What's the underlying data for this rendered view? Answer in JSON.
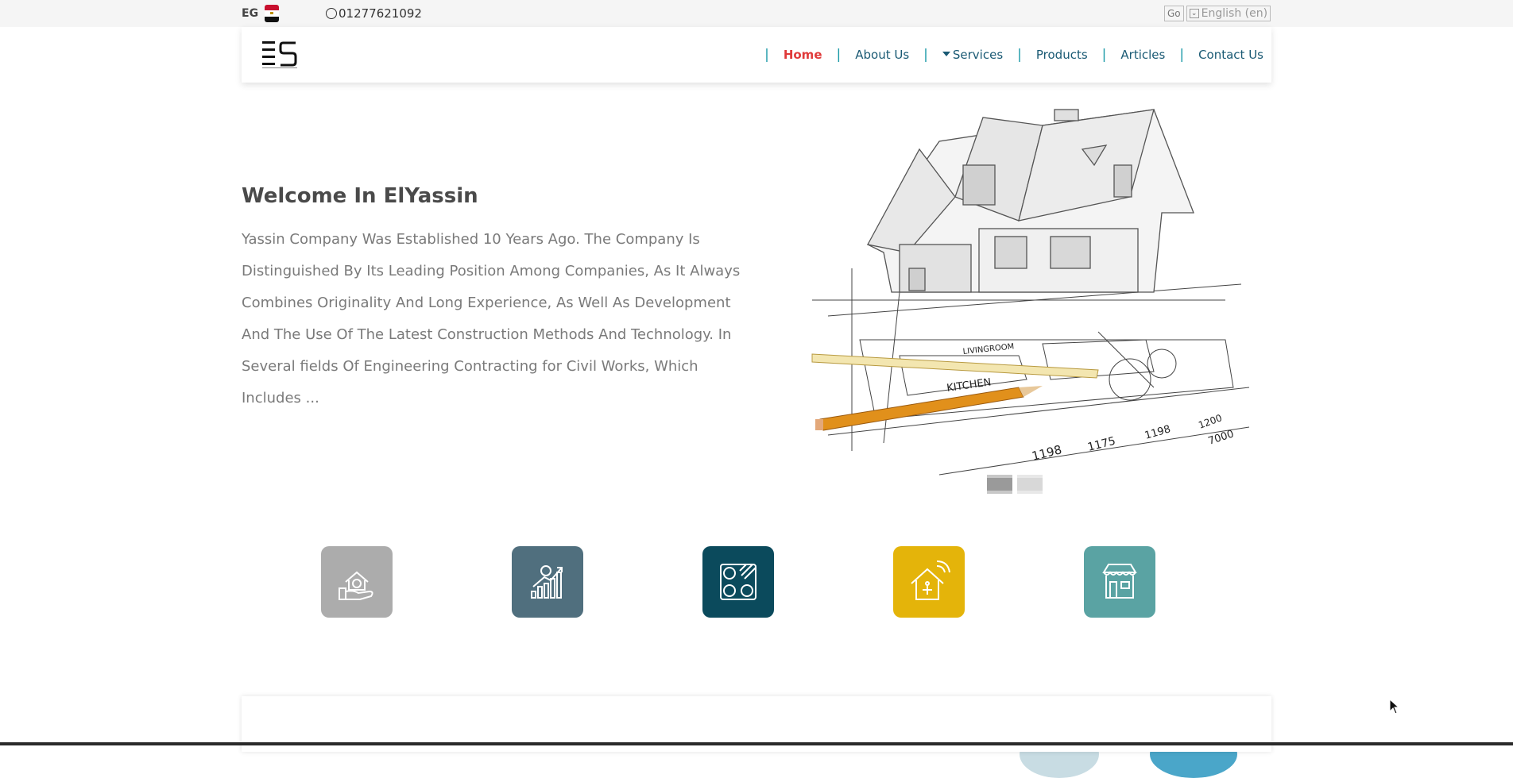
{
  "topbar": {
    "country": "EG",
    "phone": "01277621092",
    "lang_go": "Go",
    "lang_selected": "English (en)"
  },
  "nav": {
    "items": [
      {
        "label": "Home",
        "active": true
      },
      {
        "label": "About Us"
      },
      {
        "label": "Services",
        "has_dropdown": true
      },
      {
        "label": "Products"
      },
      {
        "label": "Articles"
      },
      {
        "label": "Contact Us"
      }
    ]
  },
  "hero": {
    "title": "Welcome In ElYassin",
    "text": "Yassin Company Was Established 10 Years Ago. The Company Is Distinguished By Its Leading Position Among Companies, As It Always Combines Originality And Long Experience, As Well As Development And The Use Of The Latest Construction Methods And Technology. In Several fields Of Engineering Contracting for Civil Works, Which Includes ...",
    "image_labels": {
      "kitchen": "KITCHEN",
      "living": "LIVINGROOM",
      "dims": [
        "1198",
        "1175",
        "1198",
        "1200",
        "7000"
      ]
    },
    "slider_dots": 2,
    "active_dot": 0
  },
  "tiles": [
    {
      "icon": "real-estate-hand-icon",
      "color": "#acacac"
    },
    {
      "icon": "investment-growth-icon",
      "color": "#506f7e"
    },
    {
      "icon": "tiles-materials-icon",
      "color": "#0b4a5c"
    },
    {
      "icon": "smart-home-icon",
      "color": "#e4b40a"
    },
    {
      "icon": "store-icon",
      "color": "#5aa3a3"
    }
  ],
  "colors": {
    "accent": "#1c9aa8",
    "active": "#e03a3a",
    "nav_text": "#1a5a74"
  }
}
